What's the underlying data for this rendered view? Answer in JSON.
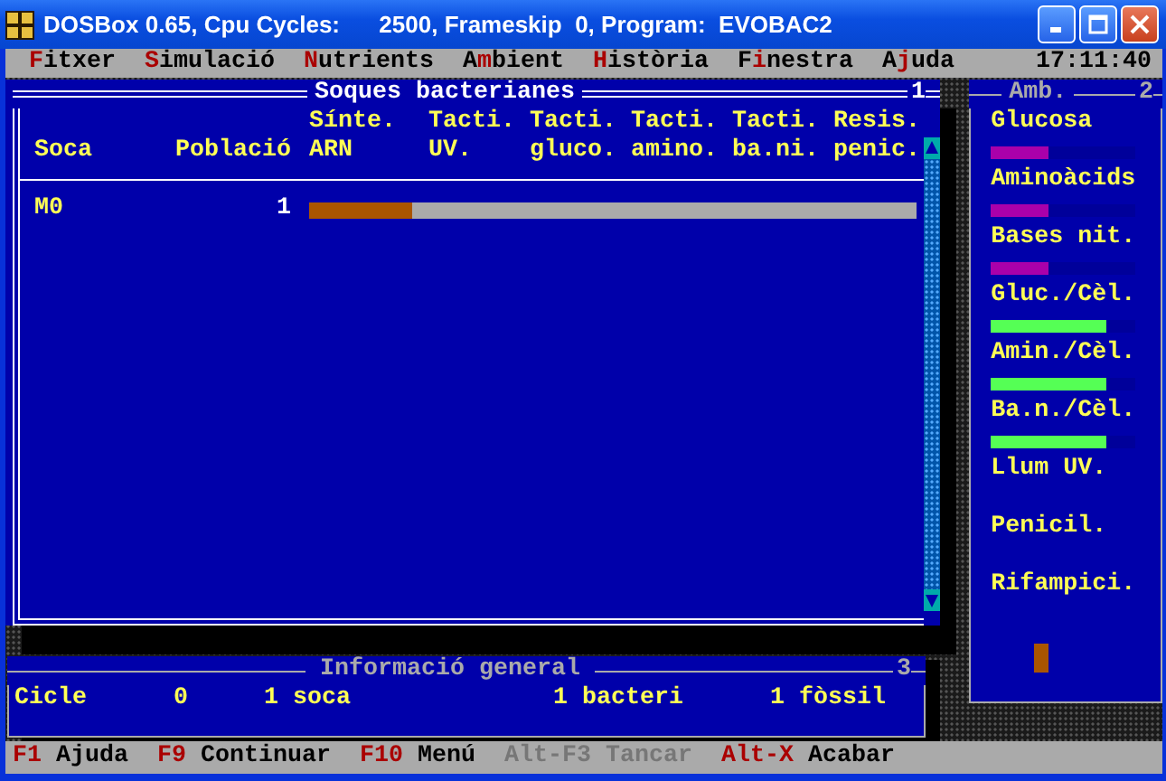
{
  "window": {
    "title": "DOSBox 0.65, Cpu Cycles:      2500, Frameskip  0, Program:  EVOBAC2"
  },
  "menu": [
    {
      "label": "**F**itxer"
    },
    {
      "label": "**S**imulació"
    },
    {
      "label": "**N**utrients"
    },
    {
      "label": "A**m**bient"
    },
    {
      "label": "**H**istòria"
    },
    {
      "label": "F**i**nestra"
    },
    {
      "label": "A**j**uda"
    }
  ],
  "clock": "17:11:40",
  "strains_window": {
    "title": "Soques bacterianes",
    "number": "1",
    "columns": [
      {
        "lines": [
          "Soca"
        ]
      },
      {
        "lines": [
          "Població"
        ]
      },
      {
        "lines": [
          "Sínte.",
          "ARN"
        ]
      },
      {
        "lines": [
          "Tacti.",
          "UV."
        ]
      },
      {
        "lines": [
          "Tacti.",
          "gluco."
        ]
      },
      {
        "lines": [
          "Tacti.",
          "amino."
        ]
      },
      {
        "lines": [
          "Tacti.",
          "ba.ni."
        ]
      },
      {
        "lines": [
          "Resis.",
          "penic."
        ]
      }
    ],
    "rows": [
      {
        "name": "M0",
        "population": "1",
        "level": 0.17
      }
    ]
  },
  "environment_window": {
    "title": "Amb.",
    "number": "2",
    "items": [
      {
        "label": "Glucosa",
        "kind": "bar",
        "color": "#aa00aa",
        "level": 0.4
      },
      {
        "label": "Aminoàcids",
        "kind": "bar",
        "color": "#aa00aa",
        "level": 0.4
      },
      {
        "label": "Bases nit.",
        "kind": "bar",
        "color": "#aa00aa",
        "level": 0.4
      },
      {
        "label": "Gluc./Cèl.",
        "kind": "bar",
        "color": "#55ff55",
        "level": 0.8
      },
      {
        "label": "Amin./Cèl.",
        "kind": "bar",
        "color": "#55ff55",
        "level": 0.8
      },
      {
        "label": "Ba.n./Cèl.",
        "kind": "bar",
        "color": "#55ff55",
        "level": 0.8
      },
      {
        "label": "Llum UV.",
        "kind": "plain"
      },
      {
        "label": "Penicil.",
        "kind": "plain"
      },
      {
        "label": "Rifampici.",
        "kind": "plain"
      }
    ]
  },
  "info_window": {
    "title": "Informació general",
    "number": "3",
    "fields": [
      "Cicle",
      "0",
      "1 soca",
      "1 bacteri",
      "1 fòssil"
    ]
  },
  "status_bar": [
    {
      "key": "F1",
      "label": "Ajuda",
      "disabled": false
    },
    {
      "key": "F9",
      "label": "Continuar",
      "disabled": false
    },
    {
      "key": "F10",
      "label": "Menú",
      "disabled": false
    },
    {
      "key": "Alt-F3",
      "label": "Tancar",
      "disabled": true
    },
    {
      "key": "Alt-X",
      "label": "Acabar",
      "disabled": false
    }
  ]
}
